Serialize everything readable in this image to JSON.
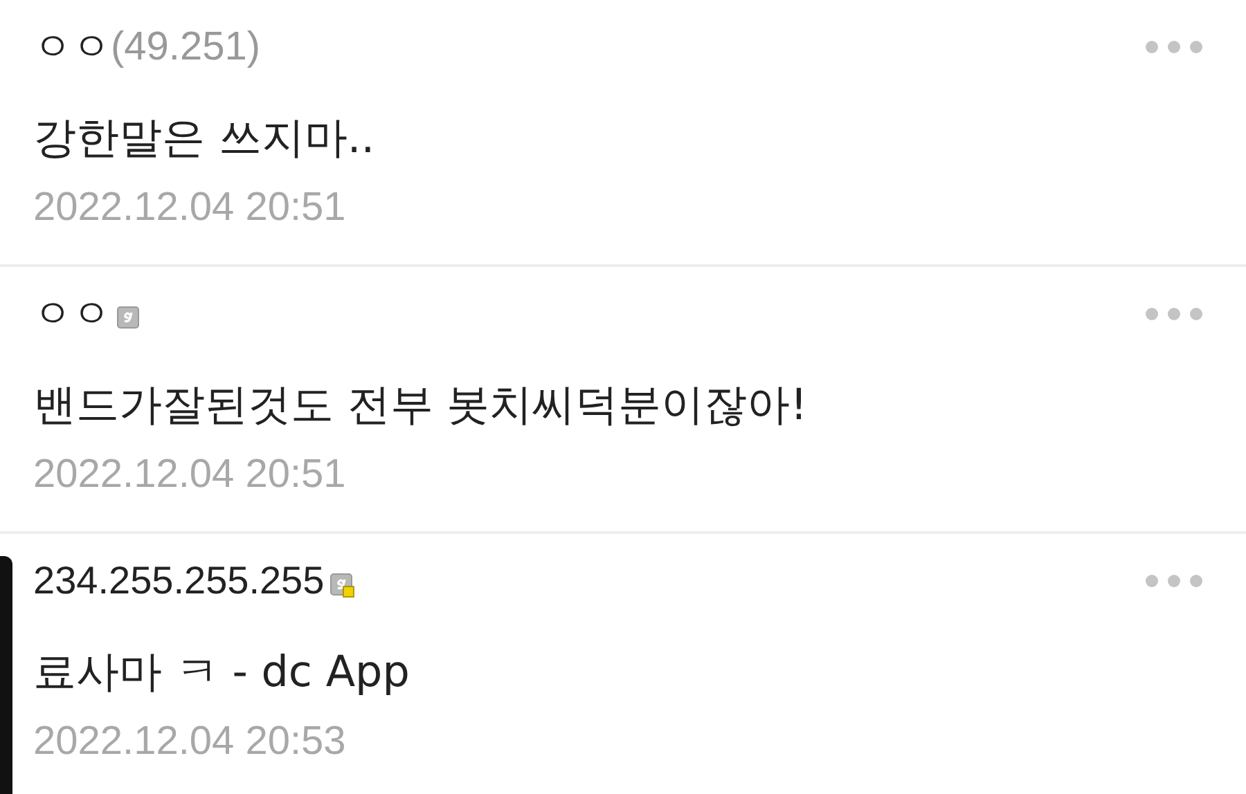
{
  "comments": [
    {
      "nickname": "ㅇㅇ",
      "ip": "(49.251)",
      "kind": "guest",
      "highlighted": false,
      "text": "강한말은 쓰지마..",
      "date": "2022.12.04 20:51"
    },
    {
      "nickname": "ㅇㅇ",
      "kind": "fixed",
      "highlighted": false,
      "text": "밴드가잘된것도 전부 봇치씨덕분이잖아!",
      "date": "2022.12.04 20:51"
    },
    {
      "nickname": "234.255.255.255",
      "kind": "semi",
      "highlighted": true,
      "text": "료사마 ㅋ - dc App",
      "date": "2022.12.04 20:53"
    }
  ]
}
